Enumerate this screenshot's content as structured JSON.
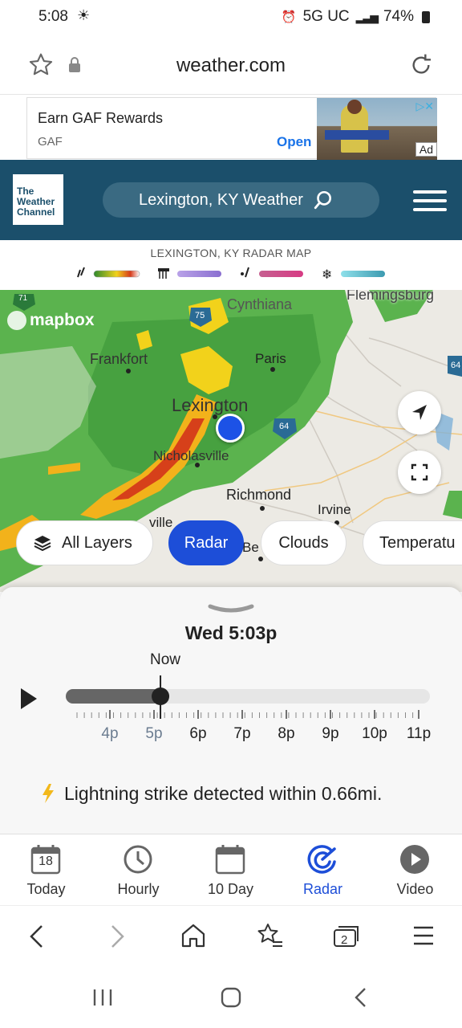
{
  "status": {
    "time": "5:08",
    "network": "5G UC",
    "battery": "74%"
  },
  "browser": {
    "url": "weather.com"
  },
  "ad": {
    "title": "Earn GAF Rewards",
    "advertiser": "GAF",
    "cta": "Open",
    "tag": "Ad"
  },
  "header": {
    "logo_line1": "The",
    "logo_line2": "Weather",
    "logo_line3": "Channel",
    "search_label": "Lexington, KY Weather"
  },
  "radar": {
    "title": "LEXINGTON, KY RADAR MAP"
  },
  "map": {
    "attribution": "mapbox",
    "places": [
      "Cynthiana",
      "Flemingsburg",
      "Frankfort",
      "Paris",
      "Lexington",
      "Nicholasville",
      "Richmond",
      "Irvine",
      "ville",
      "Be"
    ],
    "route_labels": [
      "71",
      "75",
      "64",
      "64"
    ]
  },
  "layers": {
    "all_layers": "All Layers",
    "radar": "Radar",
    "clouds": "Clouds",
    "temperature": "Temperatu"
  },
  "timeline": {
    "datetime": "Wed 5:03p",
    "now_label": "Now",
    "progress": 0.26,
    "ticks": [
      "4p",
      "5p",
      "6p",
      "7p",
      "8p",
      "9p",
      "10p",
      "11p"
    ]
  },
  "alert": {
    "text": "Lightning strike detected within 0.66mi."
  },
  "tabs": [
    {
      "label": "Today",
      "icon": "calendar-icon",
      "day": "18"
    },
    {
      "label": "Hourly",
      "icon": "clock-icon"
    },
    {
      "label": "10 Day",
      "icon": "calendar-icon"
    },
    {
      "label": "Radar",
      "icon": "radar-icon"
    },
    {
      "label": "Video",
      "icon": "play-icon"
    }
  ],
  "colors": {
    "header": "#1b4f6b",
    "accent": "#1c52e6",
    "radar_active": "#1d4ed8"
  }
}
